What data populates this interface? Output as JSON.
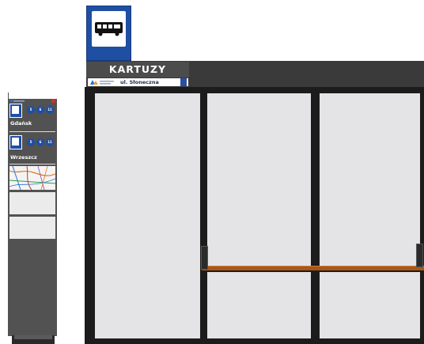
{
  "shelter": {
    "city": "KARTUZY",
    "stop_name": "ul. Słoneczna"
  },
  "totem": {
    "stops": [
      {
        "name": "Gdańsk",
        "lines": [
          "5",
          "6",
          "11"
        ]
      },
      {
        "name": "Wrzeszcz",
        "lines": [
          "5",
          "6",
          "11"
        ]
      }
    ]
  },
  "colors": {
    "sign_blue": "#1f4fa3",
    "shelter_dark": "#1c1c1c",
    "glass": "#e4e4e6",
    "bench_wood": "#a8571a",
    "totem_grey": "#525252"
  }
}
